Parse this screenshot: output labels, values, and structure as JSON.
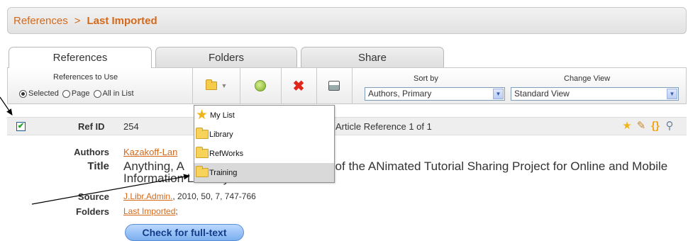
{
  "breadcrumb": {
    "parent": "References",
    "separator": ">",
    "current": "Last Imported"
  },
  "tabs": [
    {
      "label": "References",
      "active": true
    },
    {
      "label": "Folders"
    },
    {
      "label": "Share"
    }
  ],
  "toolbar": {
    "references_to_use": "References to Use",
    "options": [
      "Selected",
      "Page",
      "All in List"
    ],
    "selected_option": "Selected",
    "sort_by_label": "Sort by",
    "sort_by_value": "Authors, Primary",
    "change_view_label": "Change View",
    "change_view_value": "Standard View",
    "icons": [
      "folder-add-icon",
      "edit-icon",
      "delete-icon",
      "print-icon"
    ]
  },
  "folder_menu": [
    {
      "label": "My List",
      "icon": "star-icon"
    },
    {
      "label": "Library",
      "icon": "folder-icon"
    },
    {
      "label": "RefWorks",
      "icon": "folder-icon"
    },
    {
      "label": "Training",
      "icon": "folder-icon",
      "hover": true
    }
  ],
  "reference": {
    "checked": true,
    "ref_id_label": "Ref ID",
    "ref_id": "254",
    "count_text": "Article Reference 1 of 1",
    "authors_label": "Authors",
    "authors": "Kazakoff-Lan",
    "title_label": "Title",
    "title": "Anything, A                               Promise of the ANimated Tutorial Sharing Project for Online and Mobile Information Literacy",
    "source_label": "Source",
    "source_journal": "J.Libr.Admin.",
    "source_rest": ", 2010, 50, 7, 747-766",
    "folders_label": "Folders",
    "folders": "Last Imported",
    "folders_suffix": ";",
    "fulltext_button": "Check for full-text"
  },
  "colors": {
    "accent": "#d4691b",
    "button_blue": "#7bafef"
  }
}
